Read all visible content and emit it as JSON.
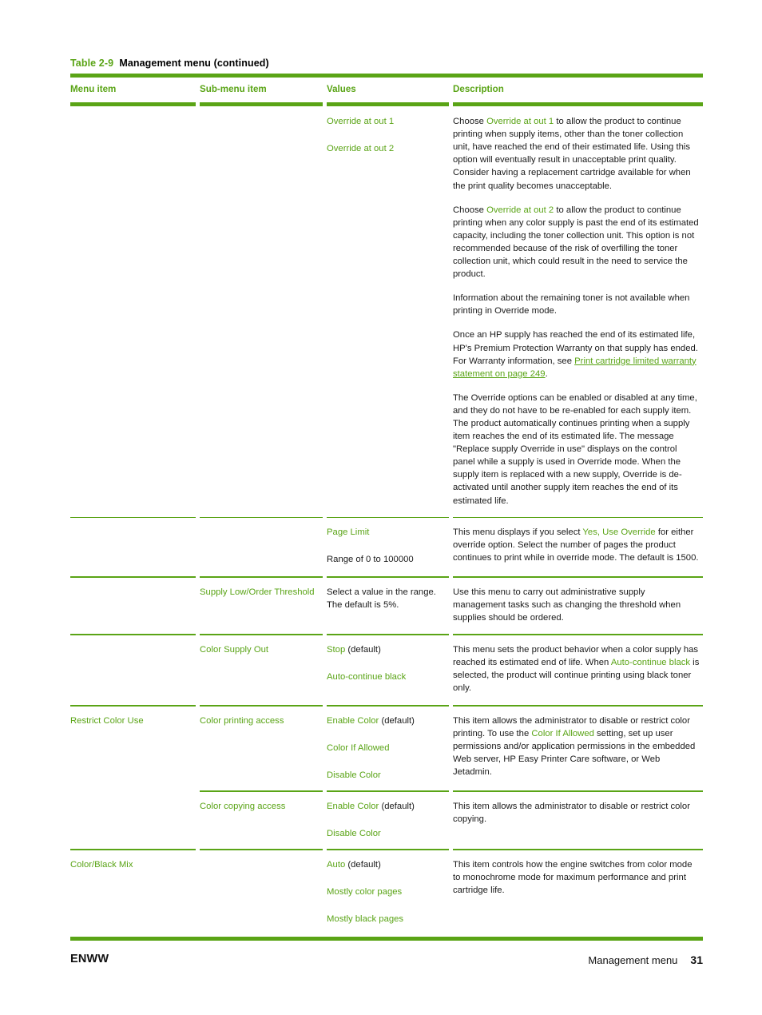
{
  "caption": {
    "number": "Table 2-9",
    "title": "Management menu (continued)"
  },
  "table": {
    "headers": {
      "menu_item": "Menu item",
      "sub_menu_item": "Sub-menu item",
      "values": "Values",
      "description": "Description"
    },
    "rows": [
      {
        "menu_item": "",
        "sub_menu_item": "",
        "values": [
          "Override at out 1",
          "Override at out 2"
        ],
        "description_paragraphs": [
          {
            "parts": [
              {
                "text": "Choose ",
                "style": "black"
              },
              {
                "text": "Override at out 1",
                "style": "green"
              },
              {
                "text": " to allow the product to continue printing when supply items, other than the toner collection unit, have reached the end of their estimated life. Using this option will eventually result in unacceptable print quality. Consider having a replacement cartridge available for when the print quality becomes unacceptable.",
                "style": "black"
              }
            ]
          },
          {
            "parts": [
              {
                "text": "Choose ",
                "style": "black"
              },
              {
                "text": "Override at out 2",
                "style": "green"
              },
              {
                "text": " to allow the product to continue printing when any color supply is past the end of its estimated capacity, including the toner collection unit. This option is not recommended because of the risk of overfilling the toner collection unit, which could result in the need to service the product.",
                "style": "black"
              }
            ]
          },
          {
            "parts": [
              {
                "text": "Information about the remaining toner is not available when printing in Override mode.",
                "style": "black"
              }
            ]
          },
          {
            "parts": [
              {
                "text": "Once an HP supply has reached the end of its estimated life, HP's Premium Protection Warranty on that supply has ended. For Warranty information, see ",
                "style": "black"
              },
              {
                "text": "Print cartridge limited warranty statement on page 249",
                "style": "link"
              },
              {
                "text": ".",
                "style": "black"
              }
            ]
          },
          {
            "parts": [
              {
                "text": "The Override options can be enabled or disabled at any time, and they do not have to be re-enabled for each supply item. The product automatically continues printing when a supply item reaches the end of its estimated life. The message \"Replace supply Override in use\" displays on the control panel while a supply is used in Override mode. When the supply item is replaced with a new supply, Override is de-activated until another supply item reaches the end of its estimated life.",
                "style": "black"
              }
            ]
          }
        ]
      },
      {
        "menu_item": "",
        "sub_menu_item": "",
        "values_rich": [
          {
            "parts": [
              {
                "text": "Page Limit",
                "style": "green"
              }
            ]
          },
          {
            "parts": [
              {
                "text": "Range of 0 to 100000",
                "style": "black"
              }
            ]
          }
        ],
        "description_paragraphs": [
          {
            "parts": [
              {
                "text": "This menu displays if you select ",
                "style": "black"
              },
              {
                "text": "Yes, Use Override",
                "style": "green"
              },
              {
                "text": " for either override option. Select the number of pages the product continues to print while in override mode. The default is 1500.",
                "style": "black"
              }
            ]
          }
        ]
      },
      {
        "menu_item": "",
        "sub_menu_item_rich": [
          {
            "parts": [
              {
                "text": "Supply Low/Order Threshold",
                "style": "green"
              }
            ]
          }
        ],
        "values_rich": [
          {
            "parts": [
              {
                "text": "Select a value in the range. The default is 5%.",
                "style": "black"
              }
            ]
          }
        ],
        "description_paragraphs": [
          {
            "parts": [
              {
                "text": "Use this menu to carry out administrative supply management tasks such as changing the threshold when supplies should be ordered.",
                "style": "black"
              }
            ]
          }
        ]
      },
      {
        "menu_item": "",
        "sub_menu_item_rich": [
          {
            "parts": [
              {
                "text": "Color Supply Out",
                "style": "green"
              }
            ]
          }
        ],
        "values_rich": [
          {
            "parts": [
              {
                "text": "Stop",
                "style": "green"
              },
              {
                "text": " (default)",
                "style": "black"
              }
            ]
          },
          {
            "parts": [
              {
                "text": "Auto-continue black",
                "style": "green"
              }
            ]
          }
        ],
        "description_paragraphs": [
          {
            "parts": [
              {
                "text": "This menu sets the product behavior when a color supply has reached its estimated end of life. When ",
                "style": "black"
              },
              {
                "text": "Auto-continue black",
                "style": "green"
              },
              {
                "text": " is selected, the product will continue printing using black toner only.",
                "style": "black"
              }
            ]
          }
        ]
      },
      {
        "menu_item_rich": [
          {
            "parts": [
              {
                "text": "Restrict Color Use",
                "style": "green"
              }
            ]
          }
        ],
        "sub_menu_item_rich": [
          {
            "parts": [
              {
                "text": "Color printing access",
                "style": "green"
              }
            ]
          }
        ],
        "values_rich": [
          {
            "parts": [
              {
                "text": "Enable Color",
                "style": "green"
              },
              {
                "text": " (default)",
                "style": "black"
              }
            ]
          },
          {
            "parts": [
              {
                "text": "Color If Allowed",
                "style": "green"
              }
            ]
          },
          {
            "parts": [
              {
                "text": "Disable Color",
                "style": "green"
              }
            ]
          }
        ],
        "description_paragraphs": [
          {
            "parts": [
              {
                "text": "This item allows the administrator to disable or restrict color printing. To use the ",
                "style": "black"
              },
              {
                "text": "Color If Allowed",
                "style": "green"
              },
              {
                "text": " setting, set up user permissions and/or application permissions in the embedded Web server, HP Easy Printer Care software, or Web Jetadmin.",
                "style": "black"
              }
            ]
          }
        ]
      },
      {
        "menu_item": "",
        "sub_menu_item_rich": [
          {
            "parts": [
              {
                "text": "Color copying access",
                "style": "green"
              }
            ]
          }
        ],
        "values_rich": [
          {
            "parts": [
              {
                "text": "Enable Color",
                "style": "green"
              },
              {
                "text": " (default)",
                "style": "black"
              }
            ]
          },
          {
            "parts": [
              {
                "text": "Disable Color",
                "style": "green"
              }
            ]
          }
        ],
        "description_paragraphs": [
          {
            "parts": [
              {
                "text": "This item allows the administrator to disable or restrict color copying.",
                "style": "black"
              }
            ]
          }
        ]
      },
      {
        "menu_item_rich": [
          {
            "parts": [
              {
                "text": "Color/Black Mix",
                "style": "green"
              }
            ]
          }
        ],
        "sub_menu_item": "",
        "values_rich": [
          {
            "parts": [
              {
                "text": "Auto",
                "style": "green"
              },
              {
                "text": " (default)",
                "style": "black"
              }
            ]
          },
          {
            "parts": [
              {
                "text": "Mostly color pages",
                "style": "green"
              }
            ]
          },
          {
            "parts": [
              {
                "text": "Mostly black pages",
                "style": "green"
              }
            ]
          }
        ],
        "description_paragraphs": [
          {
            "parts": [
              {
                "text": "This item controls how the engine switches from color mode to monochrome mode for maximum performance and print cartridge life.",
                "style": "black"
              }
            ]
          }
        ]
      }
    ]
  },
  "footer": {
    "left": "ENWW",
    "section": "Management menu",
    "page_number": "31"
  },
  "colors": {
    "accent_green": "#5aa416",
    "body_text": "#1a1a1a"
  }
}
